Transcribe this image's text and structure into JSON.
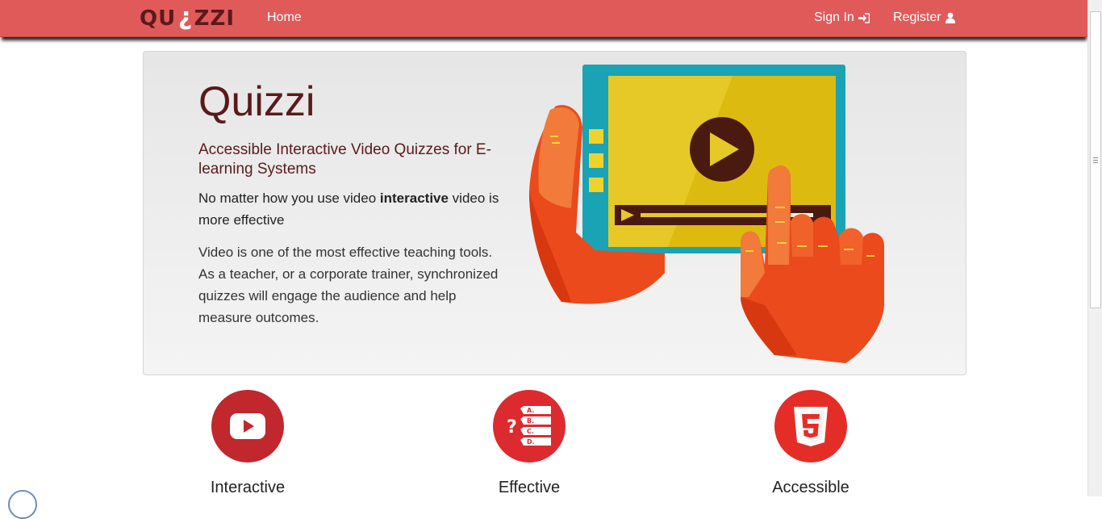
{
  "navbar": {
    "brand": {
      "left": "QU",
      "right": "ZZI"
    },
    "home": "Home",
    "sign_in": "Sign In",
    "register": "Register"
  },
  "hero": {
    "title": "Quizzi",
    "subtitle": "Accessible Interactive Video Quizzes for E-learning Systems",
    "lead_pre": "No matter how you use video ",
    "lead_bold": "interactive",
    "lead_post": " video is more effective",
    "body": "Video is one of the most effective teaching tools. As a teacher, or a corporate trainer, synchronized quizzes will engage the audience and help measure outcomes."
  },
  "features": [
    {
      "label": "Interactive",
      "icon": "youtube-play-icon",
      "color": "#c0282d"
    },
    {
      "label": "Effective",
      "icon": "quiz-list-icon",
      "color": "#dc2a2f"
    },
    {
      "label": "Accessible",
      "icon": "html5-icon",
      "color": "#e52d27"
    }
  ],
  "quiz_letters": [
    "A.",
    "B.",
    "C.",
    "D."
  ],
  "colors": {
    "navbar": "#e05a5a",
    "title": "#5a1a1a",
    "tablet_frame": "#1aa3b5",
    "screen": "#e6c926",
    "hand": "#ea4a1c"
  }
}
